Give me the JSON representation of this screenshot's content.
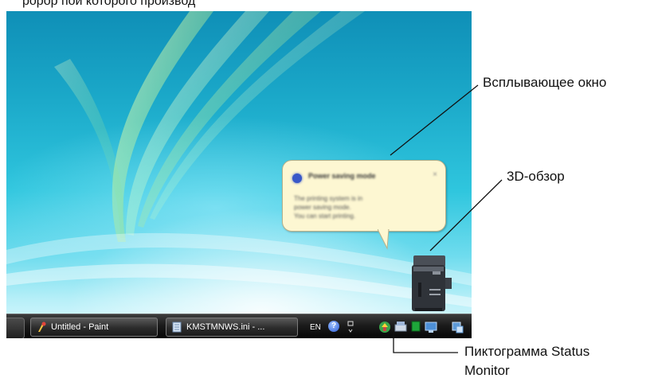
{
  "top_caption": "ророр пои которого производ",
  "callouts": {
    "popup_window": "Всплывающее окно",
    "view_3d": "3D-обзор",
    "status_monitor_line1": "Пиктограмма Status",
    "status_monitor_line2": "Monitor"
  },
  "balloon": {
    "title": "Power saving mode",
    "close": "×",
    "body_lines": [
      "The printing system is in",
      "power saving mode.",
      "You can start printing."
    ]
  },
  "taskbar": {
    "buttons": [
      {
        "label": "Untitled - Paint",
        "icon": "paint-icon"
      },
      {
        "label": "KMSTMNWS.ini - ...",
        "icon": "notepad-icon"
      }
    ],
    "language": "EN",
    "help": "?"
  },
  "colors": {
    "balloon_bg": "#fdf7d2",
    "taskbar": "#1b1b1b",
    "desktop_top": "#0f8fb7",
    "desktop_bottom": "#e8fbff"
  }
}
